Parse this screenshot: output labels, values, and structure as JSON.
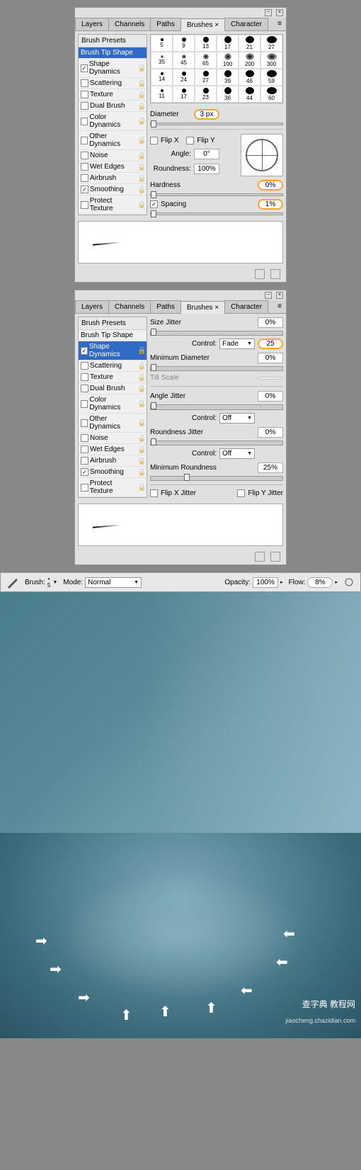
{
  "panel1": {
    "tabs": [
      "Layers",
      "Channels",
      "Paths",
      "Brushes ×",
      "Character"
    ],
    "active_tab": 3,
    "sidebar_head": "Brush Presets",
    "sidebar_items": [
      {
        "label": "Brush Tip Shape",
        "check": null,
        "sel": true
      },
      {
        "label": "Shape Dynamics",
        "check": true
      },
      {
        "label": "Scattering",
        "check": false
      },
      {
        "label": "Texture",
        "check": false
      },
      {
        "label": "Dual Brush",
        "check": false
      },
      {
        "label": "Color Dynamics",
        "check": false
      },
      {
        "label": "Other Dynamics",
        "check": false
      },
      {
        "label": "Noise",
        "check": false
      },
      {
        "label": "Wet Edges",
        "check": false
      },
      {
        "label": "Airbrush",
        "check": false
      },
      {
        "label": "Smoothing",
        "check": true
      },
      {
        "label": "Protect Texture",
        "check": false
      }
    ],
    "brush_sizes": [
      5,
      9,
      13,
      17,
      21,
      27,
      35,
      45,
      65,
      100,
      200,
      300,
      14,
      24,
      27,
      39,
      46,
      59,
      11,
      17,
      23,
      36,
      44,
      60
    ],
    "diameter_label": "Diameter",
    "diameter_value": "3 px",
    "flipx": "Flip X",
    "flipy": "Flip Y",
    "angle_label": "Angle:",
    "angle_value": "0°",
    "roundness_label": "Roundness:",
    "roundness_value": "100%",
    "hardness_label": "Hardness",
    "hardness_value": "0%",
    "spacing_label": "Spacing",
    "spacing_value": "1%"
  },
  "panel2": {
    "tabs": [
      "Layers",
      "Channels",
      "Paths",
      "Brushes ×",
      "Character"
    ],
    "sidebar_head": "Brush Presets",
    "sidebar_items": [
      {
        "label": "Brush Tip Shape",
        "check": null
      },
      {
        "label": "Shape Dynamics",
        "check": true,
        "sel": true
      },
      {
        "label": "Scattering",
        "check": false
      },
      {
        "label": "Texture",
        "check": false
      },
      {
        "label": "Dual Brush",
        "check": false
      },
      {
        "label": "Color Dynamics",
        "check": false
      },
      {
        "label": "Other Dynamics",
        "check": false
      },
      {
        "label": "Noise",
        "check": false
      },
      {
        "label": "Wet Edges",
        "check": false
      },
      {
        "label": "Airbrush",
        "check": false
      },
      {
        "label": "Smoothing",
        "check": true
      },
      {
        "label": "Protect Texture",
        "check": false
      }
    ],
    "size_jitter": "Size Jitter",
    "size_jitter_v": "0%",
    "control": "Control:",
    "control1": "Fade",
    "control1_v": "25",
    "min_diameter": "Minimum Diameter",
    "min_diameter_v": "0%",
    "tilt": "Tilt Scale",
    "angle_jitter": "Angle Jitter",
    "angle_jitter_v": "0%",
    "control2": "Off",
    "round_jitter": "Roundness Jitter",
    "round_jitter_v": "0%",
    "control3": "Off",
    "min_round": "Minimum Roundness",
    "min_round_v": "25%",
    "flip_x_j": "Flip X Jitter",
    "flip_y_j": "Flip Y Jitter"
  },
  "toolbar": {
    "brush": "Brush:",
    "brush_v": "5",
    "mode": "Mode:",
    "mode_v": "Normal",
    "opacity": "Opacity:",
    "opacity_v": "100%",
    "flow": "Flow:",
    "flow_v": "8%"
  },
  "watermark": "查字典 教程网",
  "watermark2": "jiaocheng.chazidian.com"
}
